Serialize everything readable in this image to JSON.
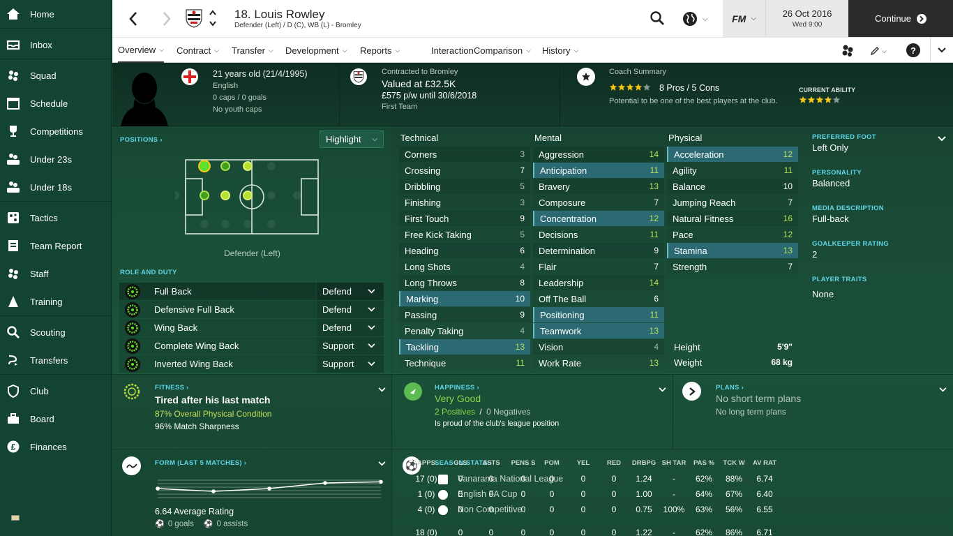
{
  "sidebar": {
    "items": [
      {
        "label": "Home",
        "icon": "home-icon"
      },
      {
        "label": "Inbox",
        "icon": "inbox-icon"
      },
      {
        "label": "Squad",
        "icon": "squad-icon"
      },
      {
        "label": "Schedule",
        "icon": "calendar-icon"
      },
      {
        "label": "Competitions",
        "icon": "trophy-icon"
      },
      {
        "label": "Under 23s",
        "icon": "u23-icon"
      },
      {
        "label": "Under 18s",
        "icon": "u18-icon"
      },
      {
        "label": "Tactics",
        "icon": "tactics-icon"
      },
      {
        "label": "Team Report",
        "icon": "report-icon"
      },
      {
        "label": "Staff",
        "icon": "staff-icon"
      },
      {
        "label": "Training",
        "icon": "training-icon"
      },
      {
        "label": "Scouting",
        "icon": "search-icon"
      },
      {
        "label": "Transfers",
        "icon": "transfers-icon"
      },
      {
        "label": "Club",
        "icon": "shield-icon"
      },
      {
        "label": "Board",
        "icon": "board-icon"
      },
      {
        "label": "Finances",
        "icon": "pound-icon"
      }
    ]
  },
  "header": {
    "player_title": "18. Louis Rowley",
    "player_subtitle": "Defender (Left) / D (C), WB (L) - Bromley",
    "fm_logo": "FM",
    "date": "26 Oct 2016",
    "day_time": "Wed 9:00",
    "continue_label": "Continue"
  },
  "tabs": [
    "Overview",
    "Contract",
    "Transfer",
    "Development",
    "Reports",
    "Interaction",
    "Comparison",
    "History"
  ],
  "profile": {
    "age": "21 years old (21/4/1995)",
    "nationality": "English",
    "caps": "0 caps / 0 goals",
    "youth_caps": "No youth caps",
    "contract_label": "Contracted to Bromley",
    "value": "Valued at £32.5K",
    "wage": "£575 p/w until 30/6/2018",
    "squad_status": "First Team",
    "coach_summary_label": "Coach Summary",
    "coach_stars": 4,
    "pros_cons": "8 Pros / 5 Cons",
    "potential_text": "Potential to be one of the best players at the club.",
    "current_ability_label": "CURRENT ABILITY",
    "current_ability_stars": 4
  },
  "positions": {
    "label": "POSITIONS",
    "highlight_label": "Highlight",
    "position_name": "Defender (Left)",
    "role_duty_label": "ROLE AND DUTY",
    "roles": [
      {
        "role": "Full Back",
        "duty": "Defend"
      },
      {
        "role": "Defensive Full Back",
        "duty": "Defend"
      },
      {
        "role": "Wing Back",
        "duty": "Defend"
      },
      {
        "role": "Complete Wing Back",
        "duty": "Support"
      },
      {
        "role": "Inverted Wing Back",
        "duty": "Support"
      }
    ]
  },
  "attributes": {
    "technical_label": "Technical",
    "mental_label": "Mental",
    "physical_label": "Physical",
    "technical": [
      {
        "name": "Corners",
        "value": "3",
        "hl": false
      },
      {
        "name": "Crossing",
        "value": "7",
        "hl": false
      },
      {
        "name": "Dribbling",
        "value": "5",
        "hl": false
      },
      {
        "name": "Finishing",
        "value": "3",
        "hl": false
      },
      {
        "name": "First Touch",
        "value": "9",
        "hl": false
      },
      {
        "name": "Free Kick Taking",
        "value": "5",
        "hl": false
      },
      {
        "name": "Heading",
        "value": "6",
        "hl": false
      },
      {
        "name": "Long Shots",
        "value": "4",
        "hl": false
      },
      {
        "name": "Long Throws",
        "value": "8",
        "hl": false
      },
      {
        "name": "Marking",
        "value": "10",
        "hl": true
      },
      {
        "name": "Passing",
        "value": "9",
        "hl": false
      },
      {
        "name": "Penalty Taking",
        "value": "4",
        "hl": false
      },
      {
        "name": "Tackling",
        "value": "13",
        "hl": true
      },
      {
        "name": "Technique",
        "value": "11",
        "hl": false
      }
    ],
    "mental": [
      {
        "name": "Aggression",
        "value": "14",
        "hl": false
      },
      {
        "name": "Anticipation",
        "value": "11",
        "hl": true
      },
      {
        "name": "Bravery",
        "value": "13",
        "hl": false
      },
      {
        "name": "Composure",
        "value": "7",
        "hl": false
      },
      {
        "name": "Concentration",
        "value": "12",
        "hl": true
      },
      {
        "name": "Decisions",
        "value": "11",
        "hl": false
      },
      {
        "name": "Determination",
        "value": "9",
        "hl": false
      },
      {
        "name": "Flair",
        "value": "7",
        "hl": false
      },
      {
        "name": "Leadership",
        "value": "14",
        "hl": false
      },
      {
        "name": "Off The Ball",
        "value": "6",
        "hl": false
      },
      {
        "name": "Positioning",
        "value": "11",
        "hl": true
      },
      {
        "name": "Teamwork",
        "value": "13",
        "hl": true
      },
      {
        "name": "Vision",
        "value": "4",
        "hl": false
      },
      {
        "name": "Work Rate",
        "value": "13",
        "hl": false
      }
    ],
    "physical": [
      {
        "name": "Acceleration",
        "value": "12",
        "hl": true
      },
      {
        "name": "Agility",
        "value": "11",
        "hl": false
      },
      {
        "name": "Balance",
        "value": "10",
        "hl": false
      },
      {
        "name": "Jumping Reach",
        "value": "7",
        "hl": false
      },
      {
        "name": "Natural Fitness",
        "value": "16",
        "hl": false
      },
      {
        "name": "Pace",
        "value": "12",
        "hl": false
      },
      {
        "name": "Stamina",
        "value": "13",
        "hl": true
      },
      {
        "name": "Strength",
        "value": "7",
        "hl": false
      }
    ],
    "height_label": "Height",
    "height": "5'9\"",
    "weight_label": "Weight",
    "weight": "68 kg"
  },
  "info": {
    "preferred_foot_label": "PREFERRED FOOT",
    "preferred_foot": "Left Only",
    "personality_label": "PERSONALITY",
    "personality": "Balanced",
    "media_label": "MEDIA DESCRIPTION",
    "media": "Full-back",
    "gk_label": "GOALKEEPER RATING",
    "gk": "2",
    "traits_label": "PLAYER TRAITS",
    "traits": "None"
  },
  "fitness": {
    "label": "FITNESS",
    "title": "Tired after his last match",
    "condition": "87% Overall Physical Condition",
    "sharpness": "96% Match Sharpness"
  },
  "happiness": {
    "label": "HAPPINESS",
    "title": "Very Good",
    "positives": "2 Positives",
    "sep": "/",
    "negatives": "0 Negatives",
    "detail": "Is proud of the club's league position"
  },
  "plans": {
    "label": "PLANS",
    "title": "No short term plans",
    "subtitle": "No long term plans"
  },
  "form": {
    "label": "FORM (LAST 5 MATCHES)",
    "ratings": [
      6.6,
      6.55,
      6.6,
      6.7,
      6.72
    ],
    "average": "6.64 Average Rating",
    "goals": "0 goals",
    "assists": "0 assists"
  },
  "season_stats": {
    "label": "SEASON STATS",
    "headers": [
      "APPS",
      "GLS",
      "ASTS",
      "PENS S",
      "POM",
      "YEL",
      "RED",
      "DRBPG",
      "SH TAR",
      "PAS %",
      "TCK W",
      "AV RAT"
    ],
    "rows": [
      {
        "comp": "Vanarama National League",
        "values": [
          "17 (0)",
          "0",
          "0",
          "0",
          "0",
          "0",
          "0",
          "1.24",
          "-",
          "62%",
          "88%",
          "6.74"
        ]
      },
      {
        "comp": "English FA Cup",
        "values": [
          "1 (0)",
          "0",
          "0",
          "0",
          "0",
          "0",
          "0",
          "1.00",
          "-",
          "64%",
          "67%",
          "6.40"
        ]
      },
      {
        "comp": "Non Competitive",
        "values": [
          "4 (0)",
          "0",
          "0",
          "0",
          "0",
          "0",
          "0",
          "0.75",
          "100%",
          "63%",
          "56%",
          "6.55"
        ]
      }
    ],
    "totals": [
      "18 (0)",
      "0",
      "0",
      "0",
      "0",
      "0",
      "0",
      "1.22",
      "-",
      "62%",
      "86%",
      "6.71"
    ]
  },
  "colors": {
    "sidebar_bg": "#134335",
    "accent_green": "#8ed34a",
    "label_cyan": "#5fd6e8",
    "highlight_row": "#2b6a73"
  }
}
